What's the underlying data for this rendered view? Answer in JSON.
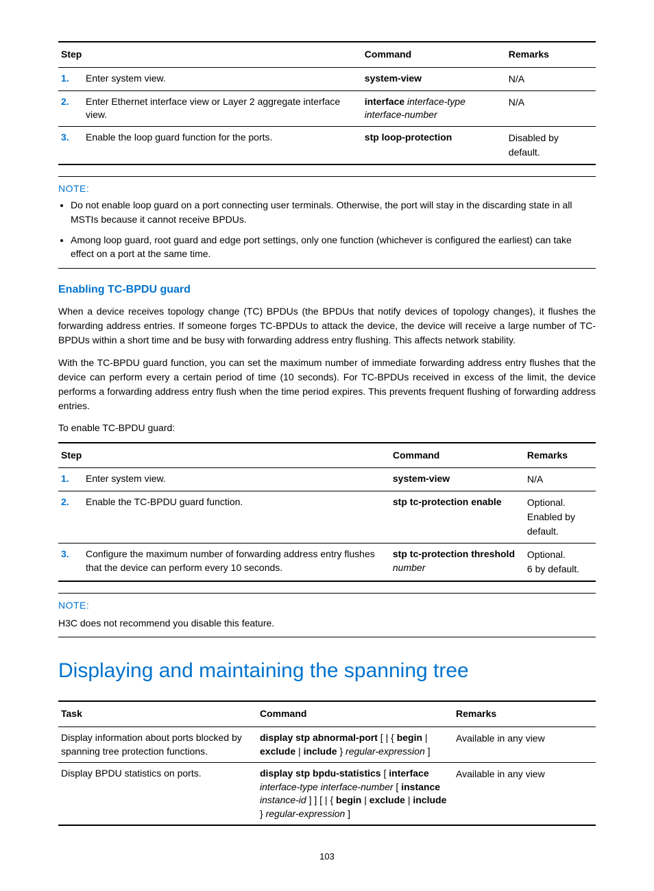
{
  "table1": {
    "headers": {
      "step": "Step",
      "command": "Command",
      "remarks": "Remarks"
    },
    "rows": [
      {
        "num": "1.",
        "step": "Enter system view.",
        "cmd_bold": "system-view",
        "cmd_ital": "",
        "remarks": "N/A"
      },
      {
        "num": "2.",
        "step": "Enter Ethernet interface view or Layer 2 aggregate interface view.",
        "cmd_bold": "interface",
        "cmd_ital": "interface-type interface-number",
        "remarks": "N/A"
      },
      {
        "num": "3.",
        "step": "Enable the loop guard function for the ports.",
        "cmd_bold": "stp loop-protection",
        "cmd_ital": "",
        "remarks": "Disabled by default."
      }
    ]
  },
  "note1": {
    "label": "NOTE:",
    "items": [
      "Do not enable loop guard on a port connecting user terminals. Otherwise, the port will stay in the discarding state in all MSTIs because it cannot receive BPDUs.",
      "Among loop guard, root guard and edge port settings, only one function (whichever is configured the earliest) can take effect on a port at the same time."
    ]
  },
  "subhead1": "Enabling TC-BPDU guard",
  "para1": "When a device receives topology change (TC) BPDUs (the BPDUs that notify devices of topology changes), it flushes the forwarding address entries. If someone forges TC-BPDUs to attack the device, the device will receive a large number of TC-BPDUs within a short time and be busy with forwarding address entry flushing. This affects network stability.",
  "para2": "With the TC-BPDU guard function, you can set the maximum number of immediate forwarding address entry flushes that the device can perform every a certain period of time (10 seconds). For TC-BPDUs received in excess of the limit, the device performs a forwarding address entry flush when the time period expires. This prevents frequent flushing of forwarding address entries.",
  "para3": "To enable TC-BPDU guard:",
  "table2": {
    "headers": {
      "step": "Step",
      "command": "Command",
      "remarks": "Remarks"
    },
    "rows": [
      {
        "num": "1.",
        "step": "Enter system view.",
        "cmd_bold": "system-view",
        "cmd_ital": "",
        "remarks1": "N/A",
        "remarks2": ""
      },
      {
        "num": "2.",
        "step": "Enable the TC-BPDU guard function.",
        "cmd_bold": "stp tc-protection enable",
        "cmd_ital": "",
        "remarks1": "Optional.",
        "remarks2": "Enabled by default."
      },
      {
        "num": "3.",
        "step": "Configure the maximum number of forwarding address entry flushes that the device can perform every 10 seconds.",
        "cmd_bold": "stp tc-protection threshold",
        "cmd_ital": "number",
        "remarks1": "Optional.",
        "remarks2": "6 by default."
      }
    ]
  },
  "note2": {
    "label": "NOTE:",
    "body": "H3C does not recommend you disable this feature."
  },
  "section_title": "Displaying and maintaining the spanning tree",
  "table3": {
    "headers": {
      "task": "Task",
      "command": "Command",
      "remarks": "Remarks"
    },
    "rows": [
      {
        "task": "Display information about ports blocked by spanning tree protection functions.",
        "cmd_parts": [
          {
            "t": "display stp abnormal-port",
            "b": true
          },
          {
            "t": " [ | { ",
            "b": false
          },
          {
            "t": "begin",
            "b": true
          },
          {
            "t": " | ",
            "b": false
          },
          {
            "t": "exclude",
            "b": true
          },
          {
            "t": " | ",
            "b": false
          },
          {
            "t": "include",
            "b": true
          },
          {
            "t": " } ",
            "b": false
          },
          {
            "t": "regular-expression",
            "i": true
          },
          {
            "t": " ]",
            "b": false
          }
        ],
        "remarks": "Available in any view"
      },
      {
        "task": "Display BPDU statistics on ports.",
        "cmd_parts": [
          {
            "t": "display stp bpdu-statistics",
            "b": true
          },
          {
            "t": " [ ",
            "b": false
          },
          {
            "t": "interface",
            "b": true
          },
          {
            "t": " ",
            "b": false
          },
          {
            "t": "interface-type interface-number",
            "i": true
          },
          {
            "t": " [ ",
            "b": false
          },
          {
            "t": "instance",
            "b": true
          },
          {
            "t": " ",
            "b": false
          },
          {
            "t": "instance-id",
            "i": true
          },
          {
            "t": " ] ] [ | { ",
            "b": false
          },
          {
            "t": "begin",
            "b": true
          },
          {
            "t": " | ",
            "b": false
          },
          {
            "t": "exclude",
            "b": true
          },
          {
            "t": " | ",
            "b": false
          },
          {
            "t": "include",
            "b": true
          },
          {
            "t": " } ",
            "b": false
          },
          {
            "t": "regular-expression",
            "i": true
          },
          {
            "t": " ]",
            "b": false
          }
        ],
        "remarks": "Available in any view"
      }
    ]
  },
  "page_number": "103"
}
